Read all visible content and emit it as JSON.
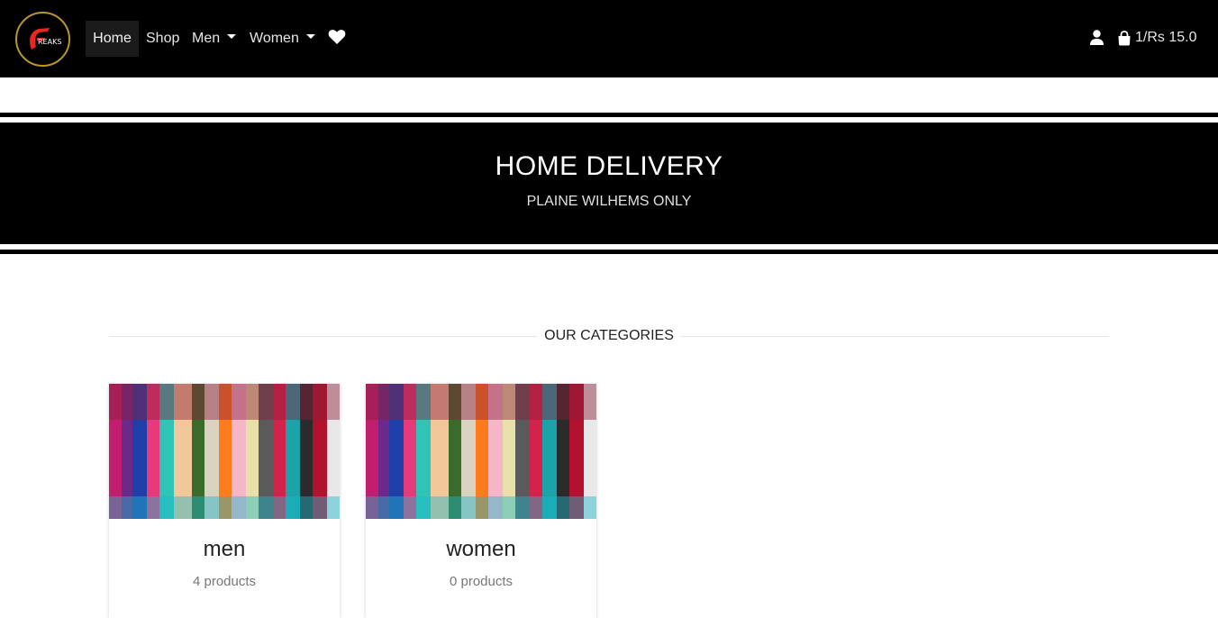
{
  "brand": {
    "logo_text": "REAKS",
    "logo_letter": "F"
  },
  "nav": {
    "items": [
      {
        "label": "Home"
      },
      {
        "label": "Shop"
      },
      {
        "label": "Men"
      },
      {
        "label": "Women"
      }
    ],
    "wishlist_icon": "heart-icon"
  },
  "account": {
    "user_icon": "user-icon",
    "cart_icon": "shopping-bag-icon",
    "cart_text": "1/Rs 15.0"
  },
  "banner": {
    "title": "HOME DELIVERY",
    "subtitle": "PLAINE WILHEMS ONLY"
  },
  "categories": {
    "section_title": "OUR CATEGORIES",
    "items": [
      {
        "name": "men",
        "count": "4 products"
      },
      {
        "name": "women",
        "count": "0 products"
      }
    ]
  },
  "colors": {
    "navbar": "#000000",
    "logo_ring": "#b8962e",
    "logo_accent": "#e8281e",
    "banner": "#000000"
  }
}
